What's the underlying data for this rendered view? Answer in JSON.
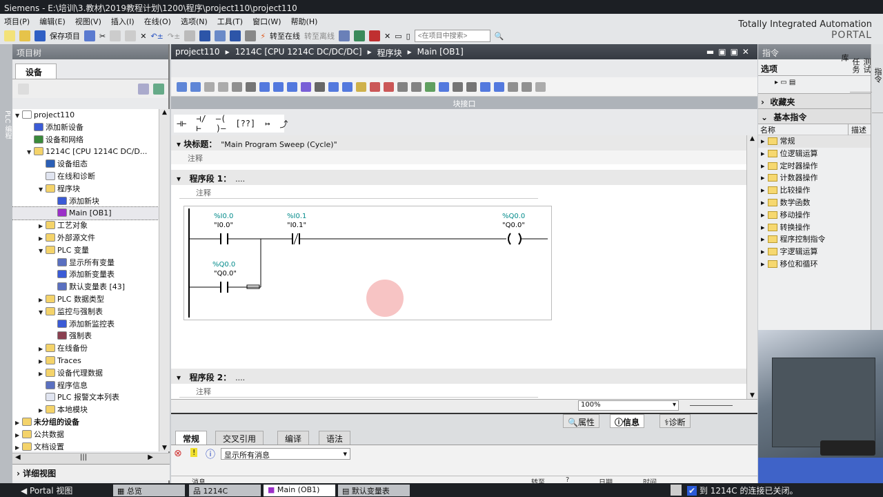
{
  "titlebar": {
    "title": "Siemens  -  E:\\培训\\3.教材\\2019教程计划\\1200\\程序\\project110\\project110"
  },
  "menu": [
    "项目(P)",
    "编辑(E)",
    "视图(V)",
    "插入(I)",
    "在线(O)",
    "选项(N)",
    "工具(T)",
    "窗口(W)",
    "帮助(H)"
  ],
  "toolbar": {
    "save": "保存项目",
    "go_online": "转至在线",
    "go_offline": "转至离线",
    "search_placeholder": "<在项目中搜索>"
  },
  "brand": {
    "line1": "Totally Integrated Automation",
    "line2": "PORTAL"
  },
  "left": {
    "strip": "PLC 编程",
    "title": "项目树",
    "tab": "设备",
    "detail": "详细视图",
    "tree": [
      {
        "label": "project110",
        "lvl": 0,
        "arr": "▼",
        "c": "#fff"
      },
      {
        "label": "添加新设备",
        "lvl": 1,
        "arr": "",
        "c": "#3b5bd6"
      },
      {
        "label": "设备和网络",
        "lvl": 1,
        "arr": "",
        "c": "#3a8a3a"
      },
      {
        "label": "1214C [CPU 1214C DC/D...",
        "lvl": 1,
        "arr": "▼",
        "c": "#f4d36a"
      },
      {
        "label": "设备组态",
        "lvl": 2,
        "arr": "",
        "c": "#2b5fb6"
      },
      {
        "label": "在线和诊断",
        "lvl": 2,
        "arr": "",
        "c": "#e0e4f0"
      },
      {
        "label": "程序块",
        "lvl": 2,
        "arr": "▼",
        "c": "#f4d36a"
      },
      {
        "label": "添加新块",
        "lvl": 3,
        "arr": "",
        "c": "#3b5bd6"
      },
      {
        "label": "Main [OB1]",
        "lvl": 3,
        "arr": "",
        "c": "#9b30c8",
        "sel": true
      },
      {
        "label": "工艺对象",
        "lvl": 2,
        "arr": "▶",
        "c": "#f4d36a"
      },
      {
        "label": "外部源文件",
        "lvl": 2,
        "arr": "▶",
        "c": "#f4d36a"
      },
      {
        "label": "PLC 变量",
        "lvl": 2,
        "arr": "▼",
        "c": "#f4d36a"
      },
      {
        "label": "显示所有变量",
        "lvl": 3,
        "arr": "",
        "c": "#5a70c0"
      },
      {
        "label": "添加新变量表",
        "lvl": 3,
        "arr": "",
        "c": "#3b5bd6"
      },
      {
        "label": "默认变量表 [43]",
        "lvl": 3,
        "arr": "",
        "c": "#5a70c0"
      },
      {
        "label": "PLC 数据类型",
        "lvl": 2,
        "arr": "▶",
        "c": "#f4d36a"
      },
      {
        "label": "监控与强制表",
        "lvl": 2,
        "arr": "▼",
        "c": "#f4d36a"
      },
      {
        "label": "添加新监控表",
        "lvl": 3,
        "arr": "",
        "c": "#3b5bd6"
      },
      {
        "label": "强制表",
        "lvl": 3,
        "arr": "",
        "c": "#8a4050"
      },
      {
        "label": "在线备份",
        "lvl": 2,
        "arr": "▶",
        "c": "#f4d36a"
      },
      {
        "label": "Traces",
        "lvl": 2,
        "arr": "▶",
        "c": "#f4d36a"
      },
      {
        "label": "设备代理数据",
        "lvl": 2,
        "arr": "▶",
        "c": "#f4d36a"
      },
      {
        "label": "程序信息",
        "lvl": 2,
        "arr": "",
        "c": "#5a70c0"
      },
      {
        "label": "PLC 报警文本列表",
        "lvl": 2,
        "arr": "",
        "c": "#e0e4f0"
      },
      {
        "label": "本地模块",
        "lvl": 2,
        "arr": "▶",
        "c": "#f4d36a"
      },
      {
        "label": "未分组的设备",
        "lvl": 0,
        "arr": "▶",
        "c": "#f4d36a",
        "bold": true
      },
      {
        "label": "公共数据",
        "lvl": 0,
        "arr": "▶",
        "c": "#f4d36a"
      },
      {
        "label": "文档设置",
        "lvl": 0,
        "arr": "▶",
        "c": "#f4d36a"
      }
    ]
  },
  "editor": {
    "breadcrumb": [
      "project110",
      "1214C [CPU 1214C DC/DC/DC]",
      "程序块",
      "Main [OB1]"
    ],
    "interface_bar": "块接口",
    "ladder_tools": [
      "⊣⊢",
      "⊣/⊢",
      "–( )–",
      "[??]",
      "↦",
      "⤴"
    ],
    "block_title_label": "块标题：",
    "block_title": "\"Main Program Sweep (Cycle)\"",
    "comment": "注释",
    "networks": [
      {
        "label": "程序段 1：",
        "title": "....",
        "comment": "注释",
        "contacts": [
          {
            "addr": "%I0.0",
            "name": "\"I0.0\""
          },
          {
            "addr": "%I0.1",
            "name": "\"I0.1\""
          }
        ],
        "coil": {
          "addr": "%Q0.0",
          "name": "\"Q0.0\""
        },
        "branch": {
          "addr": "%Q0.0",
          "name": "\"Q0.0\""
        }
      },
      {
        "label": "程序段 2：",
        "title": "....",
        "comment": "注释"
      }
    ],
    "zoom": "100%"
  },
  "inspector": {
    "tabs": [
      "属性",
      "信息",
      "诊断"
    ],
    "subtabs": [
      "常规",
      "交叉引用",
      "编译",
      "语法"
    ],
    "filter": "显示所有消息",
    "cols": [
      "消息",
      "转至",
      "?",
      "日期",
      "时间"
    ]
  },
  "instructions": {
    "title": "指令",
    "options": "选项",
    "favorites": "收藏夹",
    "basic": "基本指令",
    "col_name": "名称",
    "col_desc": "描述",
    "items": [
      "常规",
      "位逻辑运算",
      "定时器操作",
      "计数器操作",
      "比较操作",
      "数学函数",
      "移动操作",
      "转换操作",
      "程序控制指令",
      "字逻辑运算",
      "移位和循环"
    ],
    "side_tabs": [
      "指令",
      "测试",
      "任务",
      "库"
    ]
  },
  "taskbar": {
    "portal": "Portal 视图",
    "items": [
      "总览",
      "1214C",
      "Main (OB1)",
      "默认变量表"
    ],
    "status": "到 1214C 的连接已关闭。"
  }
}
